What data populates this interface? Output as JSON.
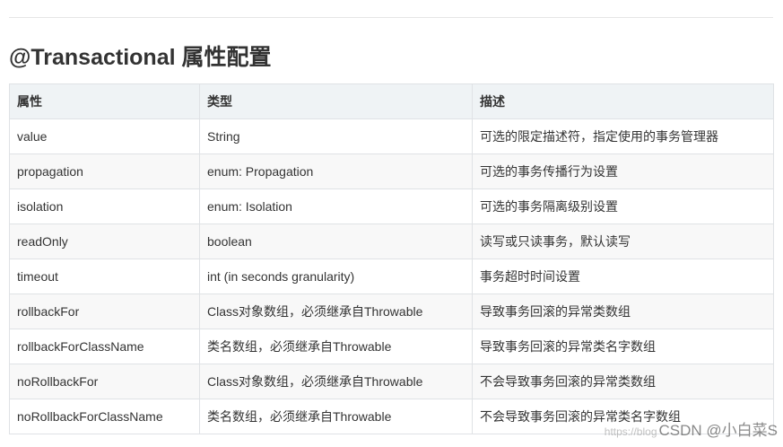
{
  "heading": "@Transactional 属性配置",
  "table": {
    "headers": [
      "属性",
      "类型",
      "描述"
    ],
    "rows": [
      [
        "value",
        "String",
        "可选的限定描述符，指定使用的事务管理器"
      ],
      [
        "propagation",
        "enum: Propagation",
        "可选的事务传播行为设置"
      ],
      [
        "isolation",
        "enum: Isolation",
        "可选的事务隔离级别设置"
      ],
      [
        "readOnly",
        "boolean",
        "读写或只读事务，默认读写"
      ],
      [
        "timeout",
        "int (in seconds granularity)",
        "事务超时时间设置"
      ],
      [
        "rollbackFor",
        "Class对象数组，必须继承自Throwable",
        "导致事务回滚的异常类数组"
      ],
      [
        "rollbackForClassName",
        "类名数组，必须继承自Throwable",
        "导致事务回滚的异常类名字数组"
      ],
      [
        "noRollbackFor",
        "Class对象数组，必须继承自Throwable",
        "不会导致事务回滚的异常类数组"
      ],
      [
        "noRollbackForClassName",
        "类名数组，必须继承自Throwable",
        "不会导致事务回滚的异常类名字数组"
      ]
    ]
  },
  "watermark": {
    "faint": "https://blog",
    "text": "CSDN @小白菜S"
  },
  "colors": {
    "header_bg": "#eff3f5",
    "stripe_bg": "#f8f8f8",
    "border": "#dfe2e5",
    "text": "#333333"
  }
}
